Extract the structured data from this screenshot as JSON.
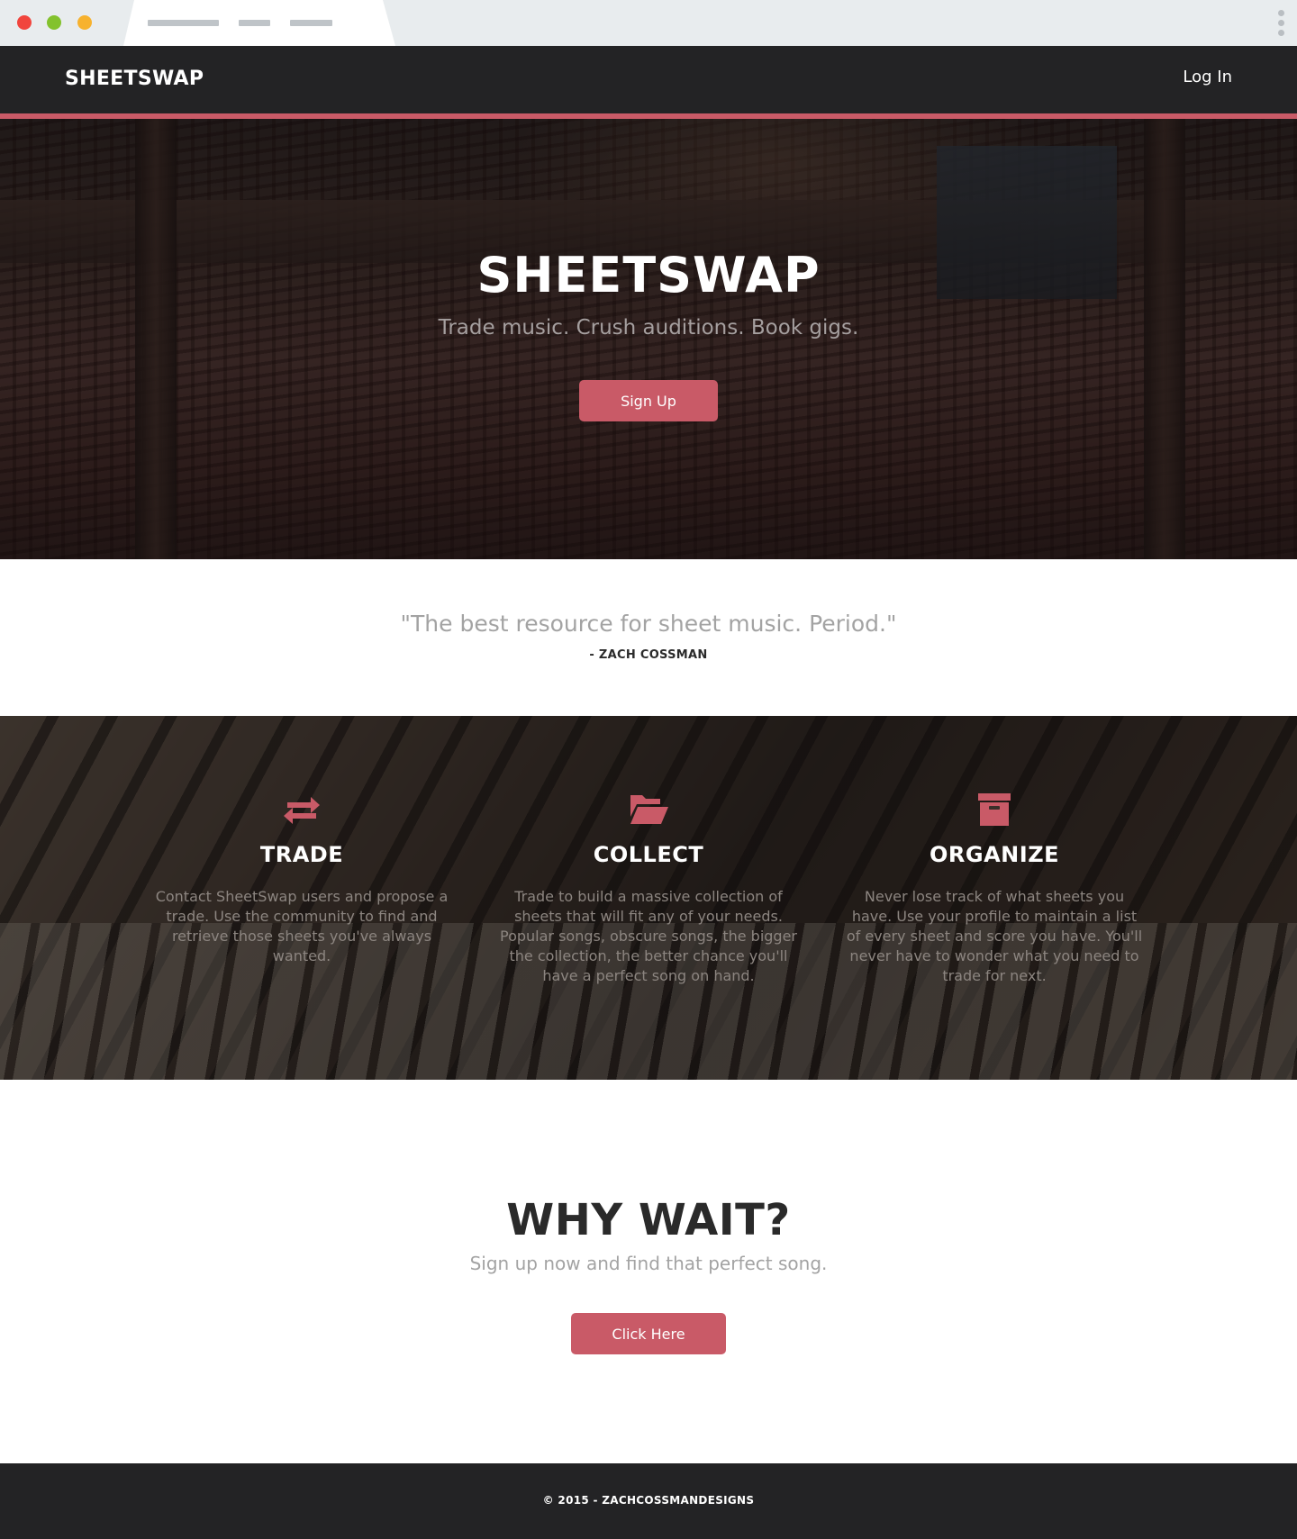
{
  "navbar": {
    "brand": "SHEETSWAP",
    "login_label": "Log In"
  },
  "hero": {
    "title": "SHEETSWAP",
    "subtitle": "Trade music. Crush auditions. Book gigs.",
    "button_label": "Sign Up"
  },
  "testimonial": {
    "quote": "\"The best resource for sheet music. Period.\"",
    "author": "- ZACH COSSMAN"
  },
  "features": [
    {
      "icon": "exchange-arrows-icon",
      "title": "TRADE",
      "description": "Contact SheetSwap users and propose a trade. Use the community to find and retrieve those sheets you've always wanted."
    },
    {
      "icon": "open-folder-icon",
      "title": "COLLECT",
      "description": "Trade to build a massive collection of sheets that will fit any of your needs. Popular songs, obscure songs, the bigger the collection, the better chance you'll have a perfect song on hand."
    },
    {
      "icon": "archive-box-icon",
      "title": "ORGANIZE",
      "description": "Never lose track of what sheets you have. Use your profile to maintain a list of every sheet and score you have. You'll never have to wonder what you need to trade for next."
    }
  ],
  "cta": {
    "title": "WHY WAIT?",
    "subtitle": "Sign up now and find that perfect song.",
    "button_label": "Click Here"
  },
  "footer": {
    "copyright": "© 2015 - ZACHCOSSMANDESIGNS"
  },
  "colors": {
    "accent": "#c95a67",
    "dark": "#232325",
    "muted_text": "#a3a3a3"
  }
}
